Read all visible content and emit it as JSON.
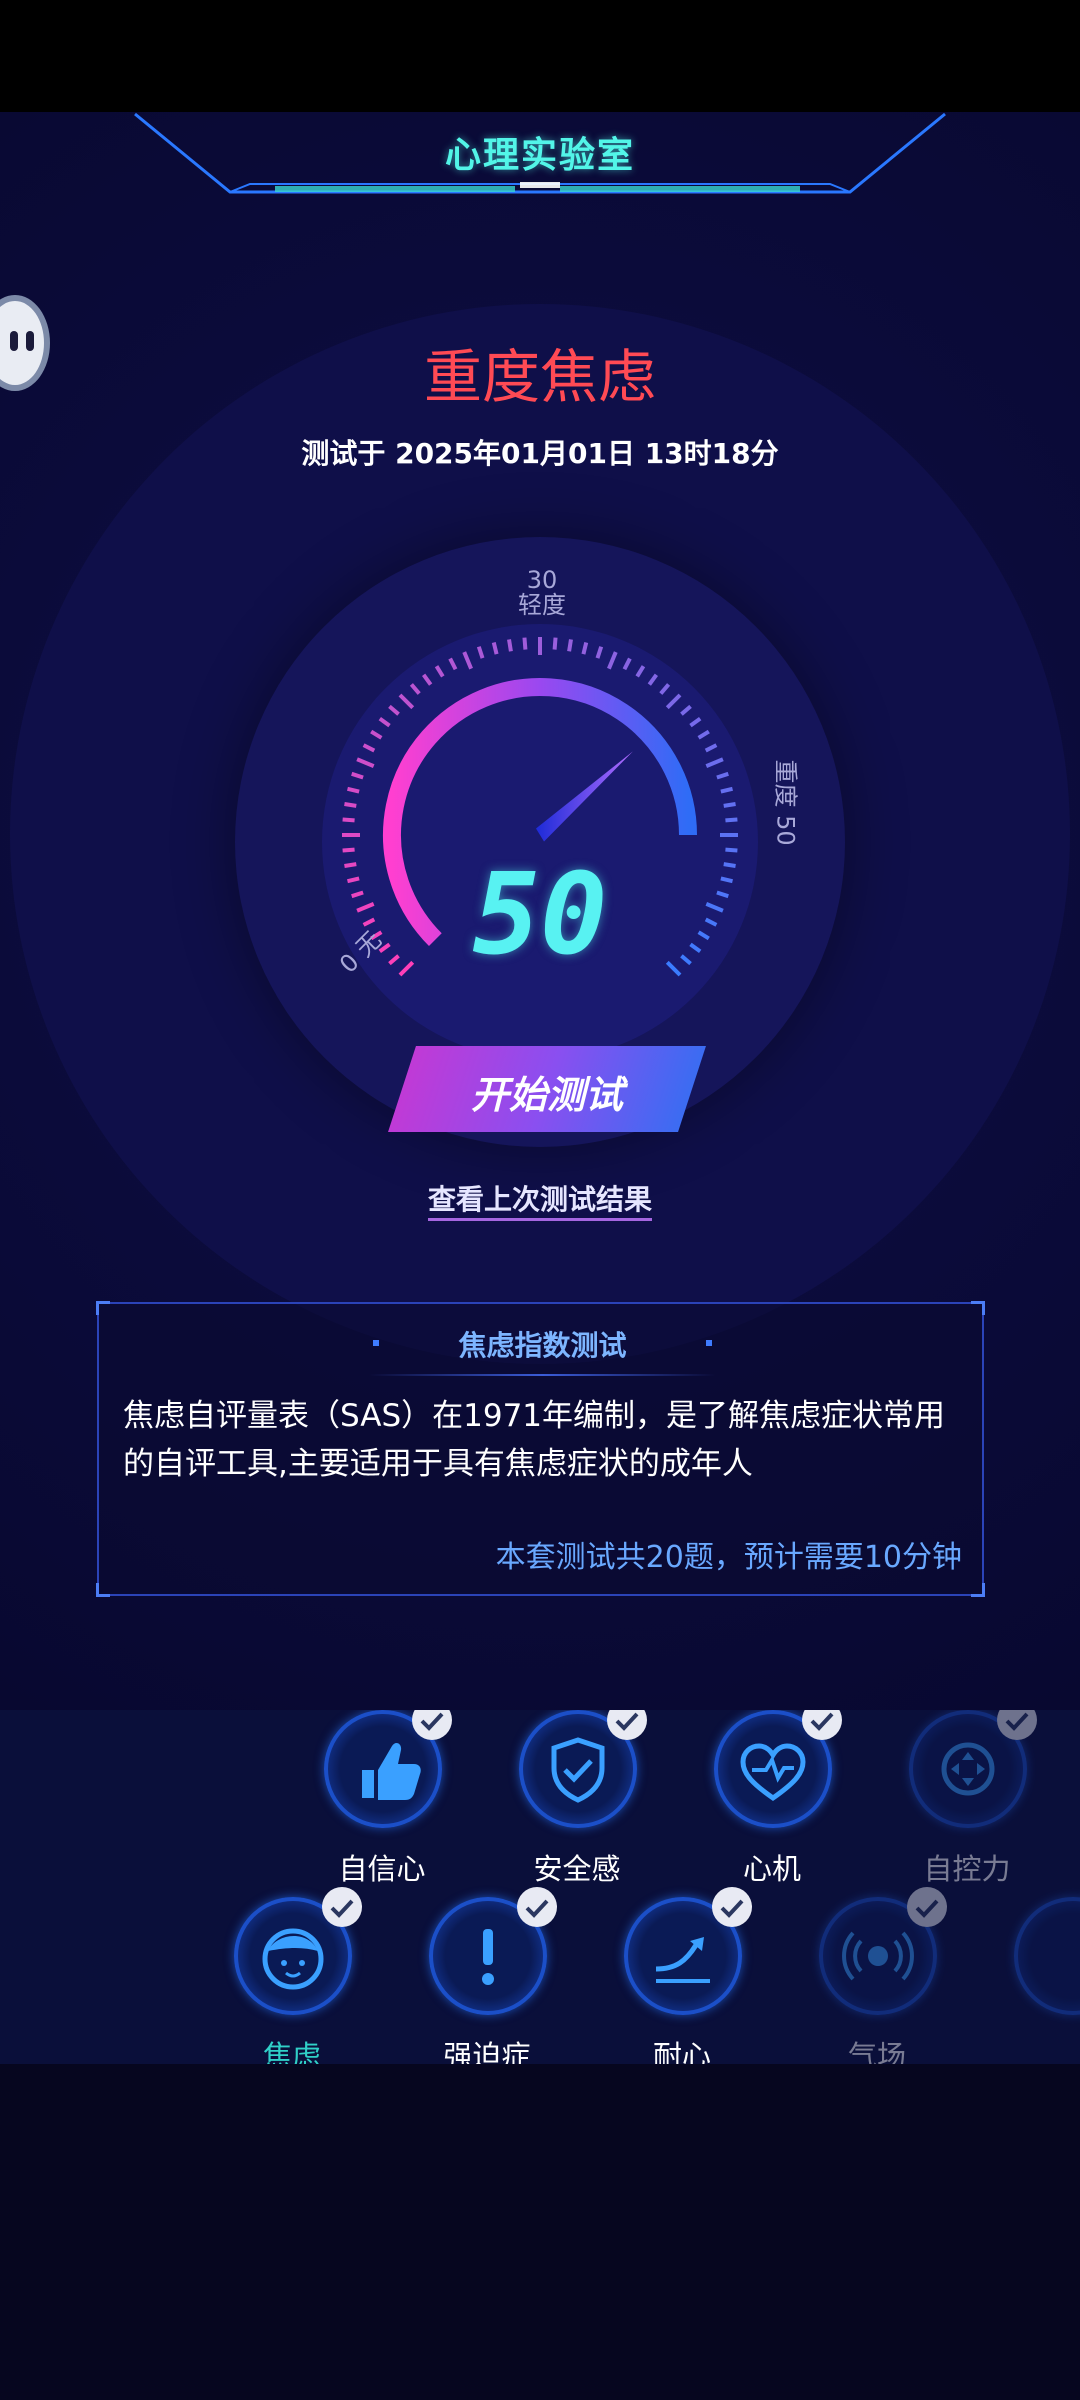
{
  "app": {
    "title": "心理实验室"
  },
  "result": {
    "level": "重度焦虑",
    "tested_at": "测试于 2025年01月01日 13时18分"
  },
  "gauge": {
    "score": "50",
    "score_value": 50,
    "max_value": 60,
    "labels": {
      "zero_num": "0",
      "zero_text": "无",
      "mid_num": "30",
      "mid_text": "轻度",
      "high_num": "50",
      "high_text": "重度"
    }
  },
  "actions": {
    "start_label": "开始测试",
    "last_result_link": "查看上次测试结果"
  },
  "info_card": {
    "title": "焦虑指数测试",
    "description": "焦虑自评量表（SAS）在1971年编制，是了解焦虑症状常用的自评工具,主要适用于具有焦虑症状的成年人",
    "note": "本套测试共20题，预计需要10分钟"
  },
  "modules": [
    {
      "label": "自信心",
      "icon": "thumbs-up-icon",
      "done": true
    },
    {
      "label": "安全感",
      "icon": "shield-check-icon",
      "done": true
    },
    {
      "label": "心机",
      "icon": "heart-pulse-icon",
      "done": true
    },
    {
      "label": "自控力",
      "icon": "move-arrows-icon",
      "done": true
    },
    {
      "label": "焦虑",
      "icon": "face-icon",
      "done": true
    },
    {
      "label": "强迫症",
      "icon": "exclamation-icon",
      "done": true
    },
    {
      "label": "耐心",
      "icon": "trend-arrow-icon",
      "done": true
    },
    {
      "label": "气场",
      "icon": "broadcast-icon",
      "done": true
    }
  ],
  "colors": {
    "accent_cyan": "#52f5e8",
    "danger_red": "#ff4a54",
    "link_blue": "#69a8ff",
    "active_teal": "#30d0c8"
  }
}
